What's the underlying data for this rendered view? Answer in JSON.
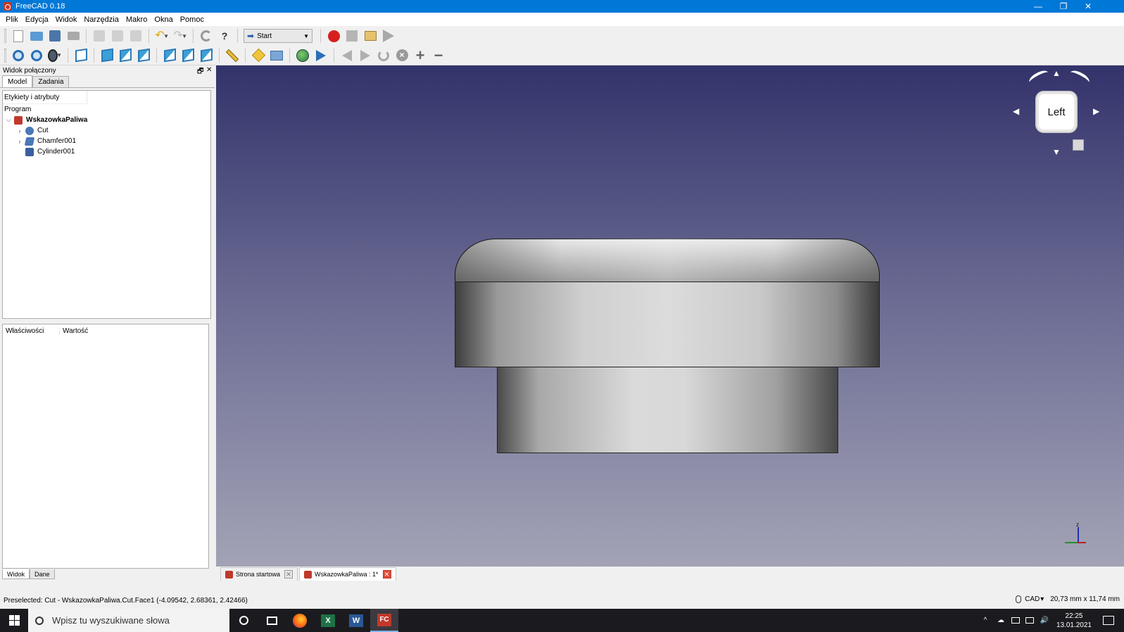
{
  "window": {
    "title": "FreeCAD 0.18",
    "minimize": "—",
    "restore": "❐",
    "close": "✕"
  },
  "menu": [
    "Plik",
    "Edycja",
    "Widok",
    "Narzędzia",
    "Makro",
    "Okna",
    "Pomoc"
  ],
  "workbench": {
    "label": "Start"
  },
  "combo_view": {
    "title": "Widok połączony",
    "float_ctl": "🗗",
    "close_ctl": "✕",
    "tabs": [
      "Model",
      "Zadania"
    ],
    "tree_header": "Etykiety i atrybuty",
    "tree_section": "Program",
    "tree": [
      {
        "label": "WskazowkaPaliwa",
        "twisty": "⌵",
        "icon_color": "#c0392b",
        "root": true
      },
      {
        "label": "Cut",
        "twisty": "›",
        "icon_color": "#4a78b5"
      },
      {
        "label": "Chamfer001",
        "twisty": "›",
        "icon_color": "#4a78b5"
      },
      {
        "label": "Cylinder001",
        "twisty": "",
        "icon_color": "#3a5fa0"
      }
    ],
    "props_headers": [
      "Właściwości",
      "Wartość"
    ],
    "bottom_tabs": [
      "Widok",
      "Dane"
    ]
  },
  "navcube": {
    "face": "Left",
    "arrow_up": "▲",
    "arrow_down": "▼",
    "arrow_left": "◀",
    "arrow_right": "▶"
  },
  "axis": {
    "z": "z"
  },
  "doc_tabs": [
    {
      "label": "Strona startowa",
      "close": "✕"
    },
    {
      "label": "WskazowkaPaliwa : 1*",
      "close": "✕"
    }
  ],
  "status": {
    "message": "Preselected: Cut - WskazowkaPaliwa.Cut.Face1 (-4.09542, 2.68361, 2.42466)",
    "nav_style": "CAD",
    "nav_drop": "▾",
    "dimensions": "20,73 mm x 11,74 mm"
  },
  "taskbar": {
    "search_placeholder": "Wpisz tu wyszukiwane słowa",
    "excel_letter": "X",
    "word_letter": "W",
    "freecad_letter": "FC",
    "tray_chevron": "^",
    "tray_cloud": "☁",
    "tray_volume": "🔊",
    "time": "22:25",
    "date": "13.01.2021"
  },
  "colors": {
    "titlebar": "#0078d7",
    "record": "#d81f1f",
    "viewport_top": "#33336b",
    "viewport_bottom": "#a3a3b6"
  }
}
